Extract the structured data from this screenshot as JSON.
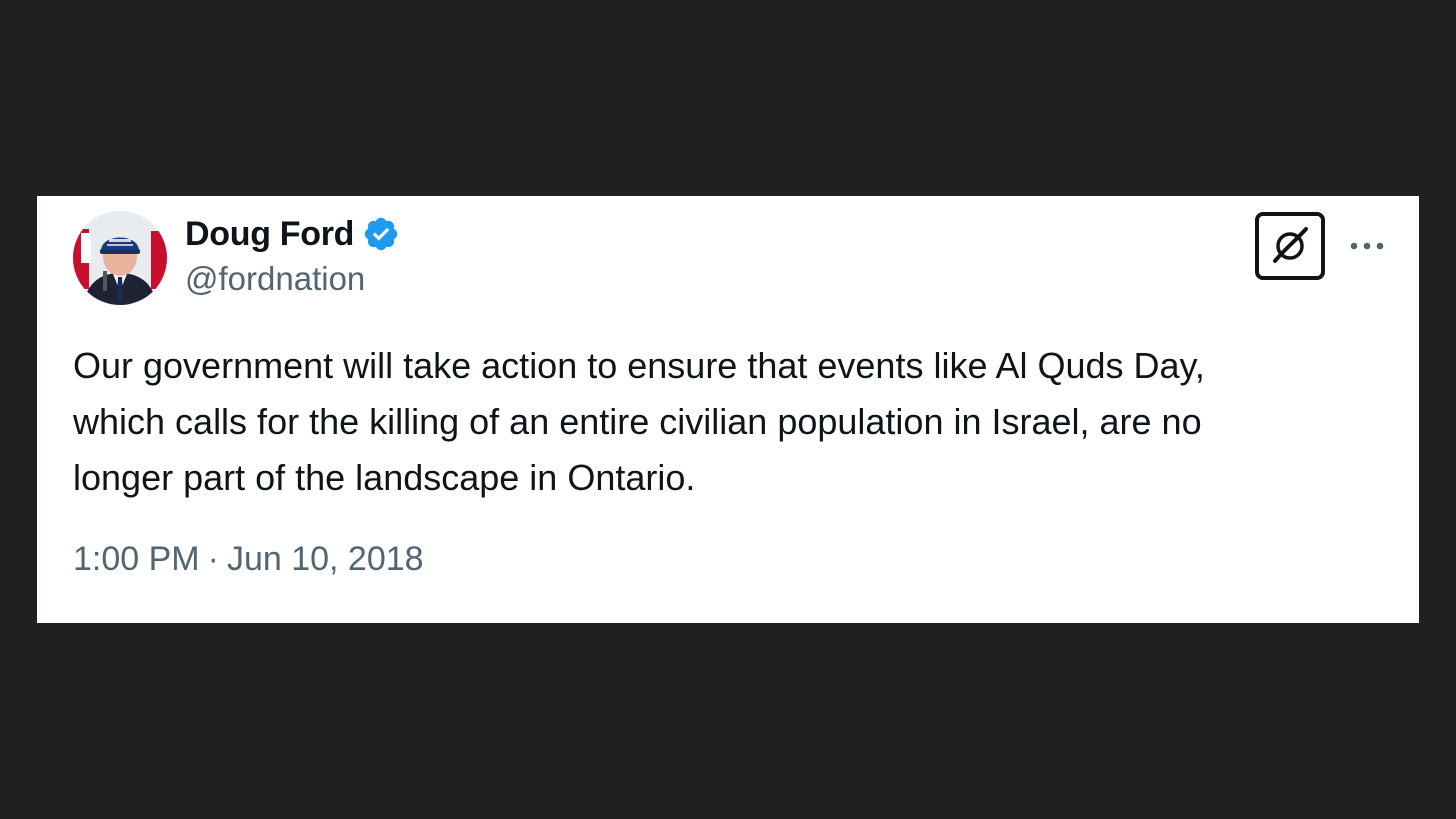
{
  "tweet": {
    "author": {
      "display_name": "Doug Ford",
      "handle": "@fordnation",
      "verified": true,
      "avatar_icon": "profile-photo"
    },
    "text": "Our government will take action to ensure that events like Al Quds Day,\nwhich calls for the killing of an entire civilian population in Israel, are no\nlonger part of the landscape in Ontario.",
    "time": "1:00 PM",
    "separator": "·",
    "date": "Jun 10, 2018"
  },
  "icons": {
    "verified": "verified-badge-icon",
    "app_badge": "slashed-circle-logo-icon",
    "more": "more-options-icon"
  },
  "colors": {
    "background": "#1e2120",
    "card": "#ffffff",
    "text_primary": "#0f1419",
    "text_secondary": "#536471",
    "verified_blue": "#1d9bf0"
  }
}
